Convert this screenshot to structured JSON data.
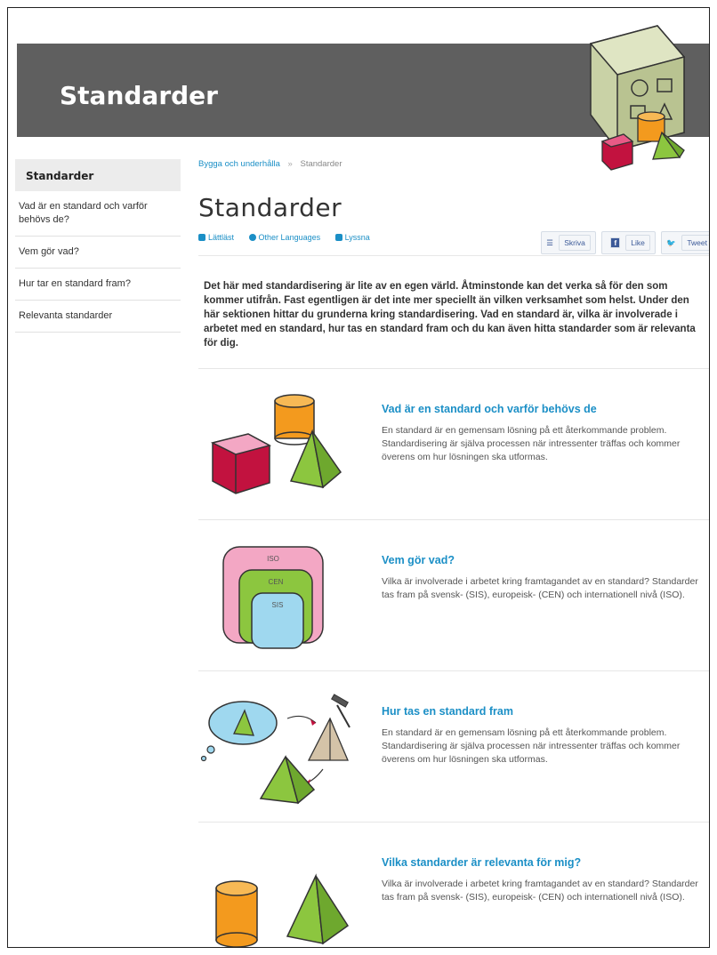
{
  "banner": {
    "title": "Standarder"
  },
  "sidebar": {
    "active": "Standarder",
    "items": [
      {
        "label": "Vad är en standard och varför behövs de?"
      },
      {
        "label": "Vem gör vad?"
      },
      {
        "label": "Hur tar en standard fram?"
      },
      {
        "label": "Relevanta standarder"
      }
    ]
  },
  "breadcrumb": {
    "parent": "Bygga och underhålla",
    "separator": "»",
    "current": "Standarder"
  },
  "page": {
    "title": "Standarder"
  },
  "toolbar": {
    "easy_read": "Lättläst",
    "languages": "Other Languages",
    "listen": "Lyssna",
    "print": "Skriva",
    "like": "Like",
    "tweet": "Tweet"
  },
  "intro": "Det här med standardisering är lite av en egen värld. Åtminstonde kan det verka så för den som kommer utifrån. Fast egentligen är det inte mer speciellt än vilken verksamhet som helst. Under den här sektionen hittar du grunderna kring standardisering. Vad en standard är, vilka är involverade i arbetet med en standard, hur tas en standard fram och du kan även hitta standarder som är relevanta för dig.",
  "sections": [
    {
      "heading": "Vad är en standard och varför behövs de",
      "text": "En standard är en gemensam lösning på ett återkommande problem. Standardisering är själva processen när intressenter träffas och kommer överens om hur lösningen ska utformas."
    },
    {
      "heading": "Vem gör vad?",
      "text": "Vilka är involverade i arbetet kring framtagandet av en standard? Standarder tas fram på svensk- (SIS), europeisk- (CEN) och internationell nivå (ISO).",
      "labels": [
        "ISO",
        "CEN",
        "SIS"
      ]
    },
    {
      "heading": "Hur tas en standard fram",
      "text": "En standard är en gemensam lösning på ett återkommande problem. Standardisering är själva processen när intressenter träffas och kommer överens om hur lösningen ska utformas."
    },
    {
      "heading": "Vilka standarder är relevanta för mig?",
      "text": "Vilka är involverade i arbetet kring framtagandet av en standard? Standarder tas fram på svensk- (SIS), europeisk- (CEN) och internationell nivå (ISO)."
    }
  ],
  "colors": {
    "banner": "#5f5f5f",
    "link": "#1b8fc6",
    "cube_red": "#c2123f",
    "cylinder_orange": "#f39a1e",
    "pyramid_green": "#8cc63f",
    "pink": "#f3a7c4",
    "light_blue": "#9fd8ef"
  }
}
